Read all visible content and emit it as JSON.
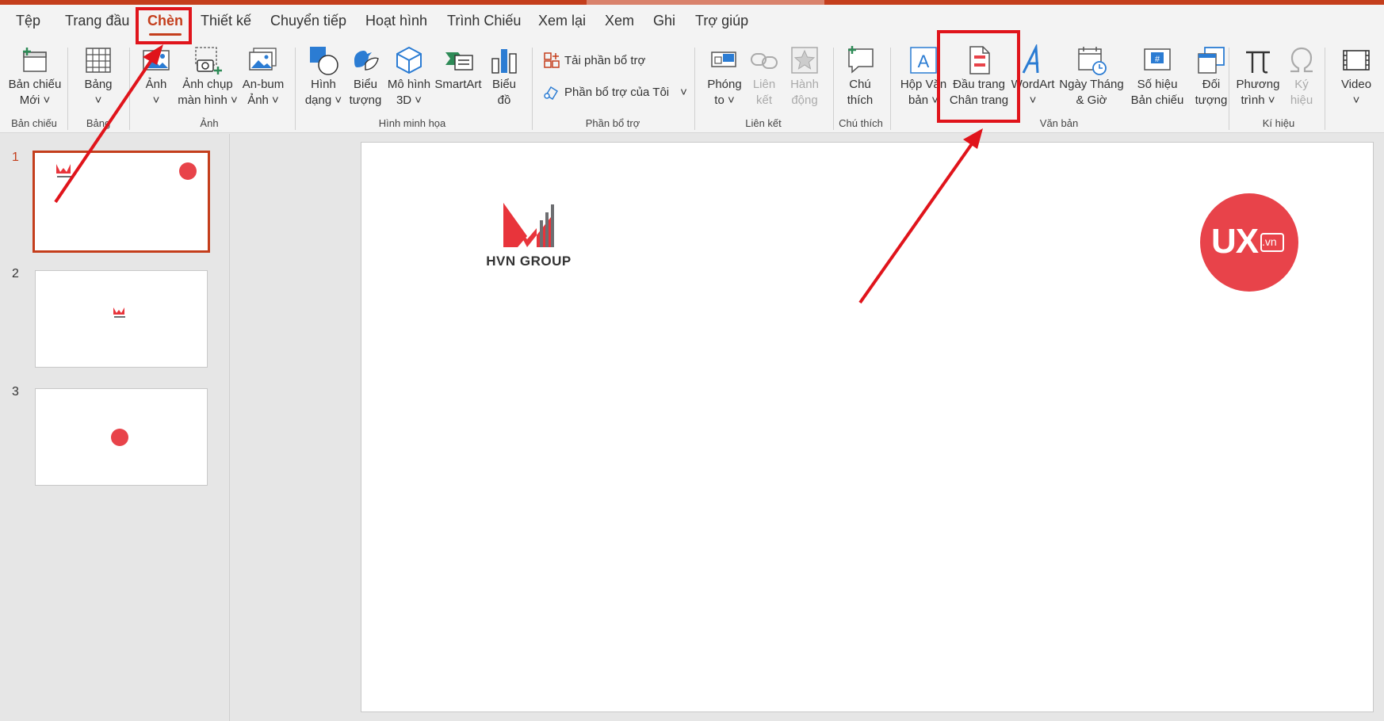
{
  "tabs": [
    "Tệp",
    "Trang đầu",
    "Chèn",
    "Thiết kế",
    "Chuyển tiếp",
    "Hoạt hình",
    "Trình Chiếu",
    "Xem lại",
    "Xem",
    "Ghi",
    "Trợ giúp"
  ],
  "active_tab": "Chèn",
  "ribbon": {
    "new_slide": "Bản chiếu\nMới ˅",
    "table": "Bảng\n˅",
    "picture": "Ảnh\n˅",
    "screenshot": "Ảnh chụp\nmàn hình ˅",
    "album": "An-bum\nẢnh ˅",
    "shapes": "Hình\ndạng ˅",
    "icons": "Biểu\ntượng",
    "models3d": "Mô hình\n3D ˅",
    "smartart": "SmartArt",
    "chart": "Biểu\nđồ",
    "get_addins": "Tải phần bổ trợ",
    "my_addins": "Phần bổ trợ của Tôi",
    "zoom": "Phóng\nto ˅",
    "link": "Liên\nkết",
    "action": "Hành\nđộng",
    "comment": "Chú\nthích",
    "textbox": "Hộp Văn\nbản ˅",
    "header_footer": "Đầu trang\nChân trang",
    "wordart": "WordArt\n˅",
    "datetime": "Ngày Tháng\n& Giờ",
    "slide_number": "Số hiệu\nBản chiếu",
    "object": "Đối\ntượng",
    "equation": "Phương\ntrình ˅",
    "symbol": "Ký\nhiệu",
    "video": "Video\n˅"
  },
  "groups": {
    "slides": "Bản chiếu",
    "tables": "Bảng",
    "images": "Ảnh",
    "illustrations": "Hình minh họa",
    "addins": "Phần bổ trợ",
    "links": "Liên kết",
    "comments": "Chú thích",
    "text": "Văn bản",
    "symbols": "Kí hiệu"
  },
  "slides": [
    "1",
    "2",
    "3"
  ],
  "current_slide": "1",
  "slide_content": {
    "left_logo_text": "HVN GROUP",
    "right_logo_text": "UX",
    "right_logo_suffix": ".vn"
  },
  "colors": {
    "accent": "#c43e1c",
    "annotation": "#e0141b",
    "ux_brand": "#e8434a",
    "hvn_red": "#e8343b",
    "hvn_gray": "#6d6e71"
  }
}
